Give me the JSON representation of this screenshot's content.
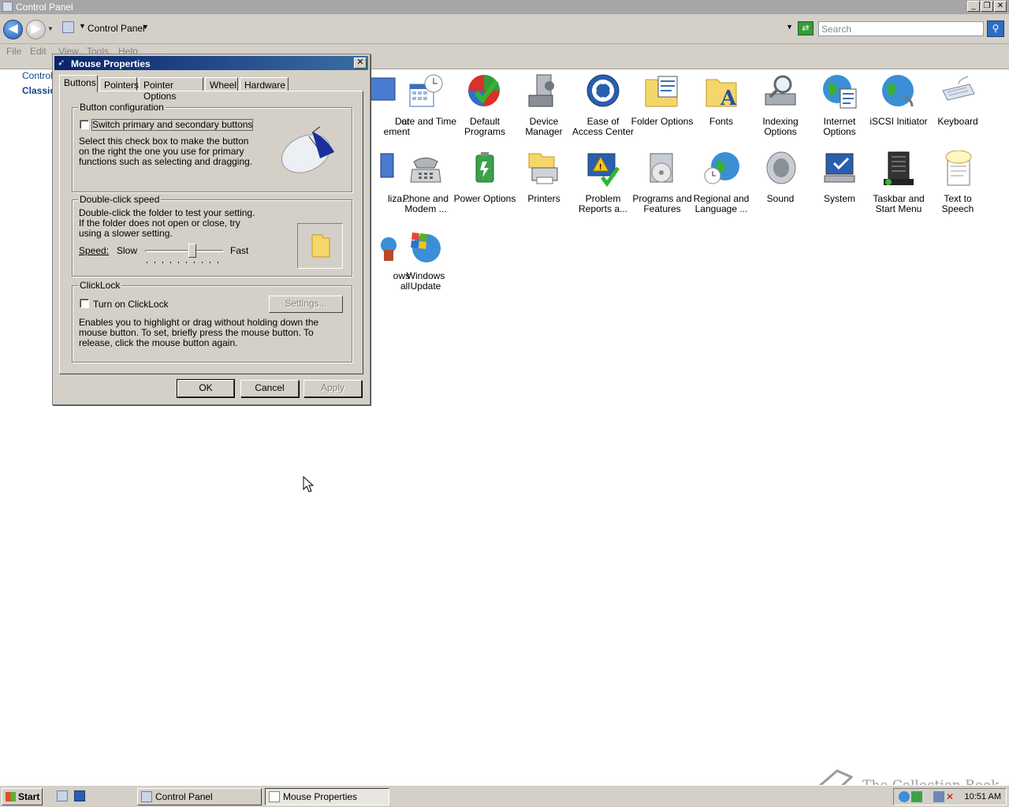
{
  "window": {
    "title": "Control Panel",
    "controls": [
      "_",
      "❐",
      "✕"
    ]
  },
  "address": {
    "crumb": "Control Panel",
    "search_placeholder": "Search"
  },
  "menu": [
    "File",
    "Edit",
    "View",
    "Tools",
    "Help"
  ],
  "left_pane": {
    "link1": "Control",
    "link2": "Classic"
  },
  "icons_row1": [
    {
      "label": "or\nement",
      "name": "partial-icon-1"
    },
    {
      "label": "Date and Time",
      "name": "date-time-icon"
    },
    {
      "label": "Default\nPrograms",
      "name": "default-programs-icon"
    },
    {
      "label": "Device\nManager",
      "name": "device-manager-icon"
    },
    {
      "label": "Ease of\nAccess Center",
      "name": "ease-of-access-icon"
    },
    {
      "label": "Folder Options",
      "name": "folder-options-icon"
    },
    {
      "label": "Fonts",
      "name": "fonts-icon"
    },
    {
      "label": "Indexing\nOptions",
      "name": "indexing-options-icon"
    },
    {
      "label": "Internet\nOptions",
      "name": "internet-options-icon"
    },
    {
      "label": "iSCSI Initiator",
      "name": "iscsi-initiator-icon"
    },
    {
      "label": "Keyboard",
      "name": "keyboard-icon"
    }
  ],
  "icons_row2": [
    {
      "label": "liza...",
      "name": "partial-icon-2"
    },
    {
      "label": "Phone and\nModem ...",
      "name": "phone-modem-icon"
    },
    {
      "label": "Power Options",
      "name": "power-options-icon"
    },
    {
      "label": "Printers",
      "name": "printers-icon"
    },
    {
      "label": "Problem\nReports a...",
      "name": "problem-reports-icon"
    },
    {
      "label": "Programs and\nFeatures",
      "name": "programs-features-icon"
    },
    {
      "label": "Regional and\nLanguage ...",
      "name": "regional-language-icon"
    },
    {
      "label": "Sound",
      "name": "sound-icon"
    },
    {
      "label": "System",
      "name": "system-icon"
    },
    {
      "label": "Taskbar and\nStart Menu",
      "name": "taskbar-start-menu-icon"
    },
    {
      "label": "Text to\nSpeech",
      "name": "text-to-speech-icon"
    }
  ],
  "icons_row3": [
    {
      "label": "ows\nall",
      "name": "partial-icon-3"
    },
    {
      "label": "Windows\nUpdate",
      "name": "windows-update-icon"
    }
  ],
  "dialog": {
    "title": "Mouse Properties",
    "tabs": [
      "Buttons",
      "Pointers",
      "Pointer Options",
      "Wheel",
      "Hardware"
    ],
    "button_config": {
      "title": "Button configuration",
      "checkbox_label": "Switch primary and secondary buttons",
      "description": "Select this check box to make the button on the right the one you use for primary functions such as selecting and dragging."
    },
    "double_click": {
      "title": "Double-click speed",
      "description": "Double-click the folder to test your setting. If the folder does not open or close, try using a slower setting.",
      "speed_label": "Speed:",
      "slow": "Slow",
      "fast": "Fast",
      "speed_level": 0.6
    },
    "clicklock": {
      "title": "ClickLock",
      "checkbox_label": "Turn on ClickLock",
      "settings_button": "Settings...",
      "description": "Enables you to highlight or drag without holding down the mouse button. To set, briefly press the mouse button. To release, click the mouse button again."
    },
    "buttons": {
      "ok": "OK",
      "cancel": "Cancel",
      "apply": "Apply"
    }
  },
  "taskbar": {
    "start": "Start",
    "tasks": [
      "Control Panel",
      "Mouse Properties"
    ],
    "clock": "10:51 AM",
    "watermark": "The Collection Book"
  }
}
